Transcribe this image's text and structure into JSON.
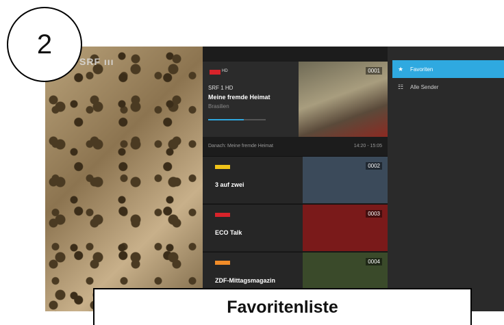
{
  "step_number": "2",
  "caption": "Favoritenliste",
  "video": {
    "channel_logo": "SRF ııı"
  },
  "current": {
    "channel_name": "SRF 1 HD",
    "hd_label": "HD",
    "title": "Meine fremde Heimat",
    "subtitle": "Brasilien",
    "number": "0001",
    "progress": 0.62
  },
  "next": {
    "label": "Danach:  Meine fremde Heimat",
    "time": "14:20 - 15:05"
  },
  "channels": [
    {
      "name": "3 auf zwei",
      "number": "0002",
      "logo_color": "#f0c419",
      "thumb_color": "#3b4a5a"
    },
    {
      "name": "ECO Talk",
      "number": "0003",
      "logo_color": "#d8232a",
      "thumb_color": "#7a1a1a"
    },
    {
      "name": "ZDF-Mittagsmagazin",
      "number": "0004",
      "logo_color": "#f28c28",
      "thumb_color": "#3a4a2a"
    }
  ],
  "menu": [
    {
      "label": "Favoriten",
      "icon": "star-icon",
      "active": true
    },
    {
      "label": "Alle Sender",
      "icon": "list-icon",
      "active": false
    }
  ],
  "colors": {
    "accent": "#2fa9e0"
  }
}
